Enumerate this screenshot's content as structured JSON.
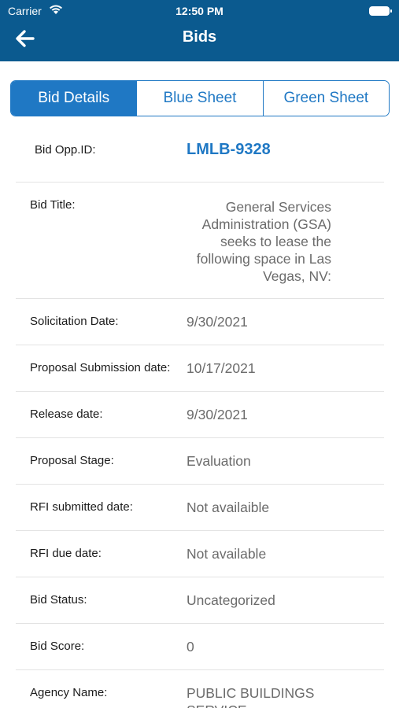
{
  "status_bar": {
    "carrier": "Carrier",
    "time": "12:50 PM"
  },
  "nav": {
    "title": "Bids"
  },
  "tabs": [
    {
      "label": "Bid Details",
      "active": true
    },
    {
      "label": "Blue Sheet",
      "active": false
    },
    {
      "label": "Green Sheet",
      "active": false
    }
  ],
  "details": {
    "bid_opp_id": {
      "label": "Bid Opp.ID:",
      "value": "LMLB-9328"
    },
    "bid_title": {
      "label": "Bid Title:",
      "value": "General Services Administration (GSA) seeks to lease the following space in Las Vegas, NV:"
    },
    "solicitation_date": {
      "label": "Solicitation Date:",
      "value": "9/30/2021"
    },
    "proposal_submission_date": {
      "label": "Proposal Submission date:",
      "value": "10/17/2021"
    },
    "release_date": {
      "label": "Release date:",
      "value": "9/30/2021"
    },
    "proposal_stage": {
      "label": "Proposal Stage:",
      "value": "Evaluation"
    },
    "rfi_submitted_date": {
      "label": "RFI submitted date:",
      "value": "Not availaible"
    },
    "rfi_due_date": {
      "label": "RFI due date:",
      "value": "Not available"
    },
    "bid_status": {
      "label": "Bid Status:",
      "value": "Uncategorized"
    },
    "bid_score": {
      "label": "Bid Score:",
      "value": "0"
    },
    "agency_name": {
      "label": "Agency Name:",
      "value": "PUBLIC BUILDINGS SERVICE"
    }
  },
  "colors": {
    "header_bg": "#0b5a8f",
    "accent": "#1f78c4",
    "value_text": "#6b6b6b"
  }
}
